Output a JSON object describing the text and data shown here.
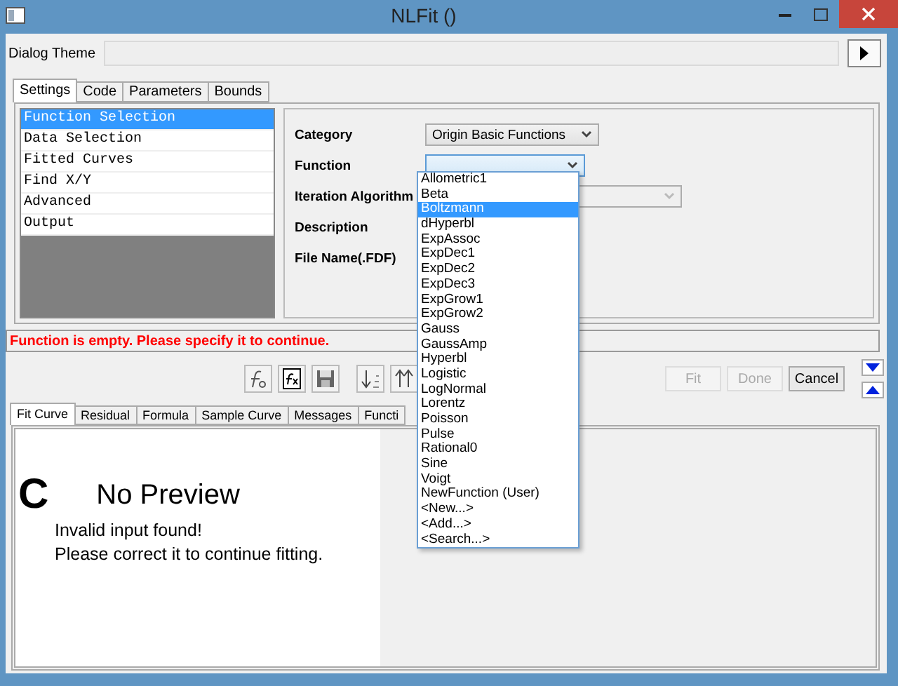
{
  "window": {
    "title": "NLFit ()"
  },
  "dialog_theme": {
    "label": "Dialog Theme"
  },
  "tabs": [
    {
      "label": "Settings",
      "selected": true
    },
    {
      "label": "Code",
      "selected": false
    },
    {
      "label": "Parameters",
      "selected": false
    },
    {
      "label": "Bounds",
      "selected": false
    }
  ],
  "sidebar": {
    "items": [
      {
        "label": "Function Selection",
        "selected": true
      },
      {
        "label": "Data Selection",
        "selected": false
      },
      {
        "label": "Fitted Curves",
        "selected": false
      },
      {
        "label": "Find X/Y",
        "selected": false
      },
      {
        "label": "Advanced",
        "selected": false
      },
      {
        "label": "Output",
        "selected": false
      }
    ]
  },
  "form": {
    "fields": [
      {
        "label": "Category",
        "kind": "select",
        "value": "Origin Basic Functions",
        "disabled": false,
        "open": false
      },
      {
        "label": "Function",
        "kind": "select",
        "disabled": false,
        "open": true
      },
      {
        "label": "Iteration Algorithm",
        "kind": "select",
        "disabled": true,
        "open": false
      },
      {
        "label": "Description",
        "kind": "plain"
      },
      {
        "label": "File Name(.FDF)",
        "kind": "plain"
      }
    ]
  },
  "dropdown": {
    "options": [
      {
        "label": "Allometric1",
        "selected": false
      },
      {
        "label": "Beta",
        "selected": false
      },
      {
        "label": "Boltzmann",
        "selected": true
      },
      {
        "label": "dHyperbl",
        "selected": false
      },
      {
        "label": "ExpAssoc",
        "selected": false
      },
      {
        "label": "ExpDec1",
        "selected": false
      },
      {
        "label": "ExpDec2",
        "selected": false
      },
      {
        "label": "ExpDec3",
        "selected": false
      },
      {
        "label": "ExpGrow1",
        "selected": false
      },
      {
        "label": "ExpGrow2",
        "selected": false
      },
      {
        "label": "Gauss",
        "selected": false
      },
      {
        "label": "GaussAmp",
        "selected": false
      },
      {
        "label": "Hyperbl",
        "selected": false
      },
      {
        "label": "Logistic",
        "selected": false
      },
      {
        "label": "LogNormal",
        "selected": false
      },
      {
        "label": "Lorentz",
        "selected": false
      },
      {
        "label": "Poisson",
        "selected": false
      },
      {
        "label": "Pulse",
        "selected": false
      },
      {
        "label": "Rational0",
        "selected": false
      },
      {
        "label": "Sine",
        "selected": false
      },
      {
        "label": "Voigt",
        "selected": false
      },
      {
        "label": "NewFunction (User)",
        "selected": false
      },
      {
        "label": "<New...>",
        "selected": false
      },
      {
        "label": "<Add...>",
        "selected": false
      },
      {
        "label": "<Search...>",
        "selected": false
      }
    ]
  },
  "error_message": "Function is empty. Please specify it to continue.",
  "buttons": [
    {
      "label": "Fit",
      "disabled": true
    },
    {
      "label": "Done",
      "disabled": true
    },
    {
      "label": "Cancel",
      "disabled": false
    }
  ],
  "preview_tabs": [
    {
      "label": "Fit Curve",
      "selected": true
    },
    {
      "label": "Residual",
      "selected": false
    },
    {
      "label": "Formula",
      "selected": false
    },
    {
      "label": "Sample Curve",
      "selected": false
    },
    {
      "label": "Messages",
      "selected": false
    },
    {
      "label": "Functi",
      "selected": false
    }
  ],
  "preview": {
    "mark": "C",
    "title": "No Preview",
    "lines": [
      "Invalid input found!",
      "Please correct it to continue fitting."
    ]
  }
}
